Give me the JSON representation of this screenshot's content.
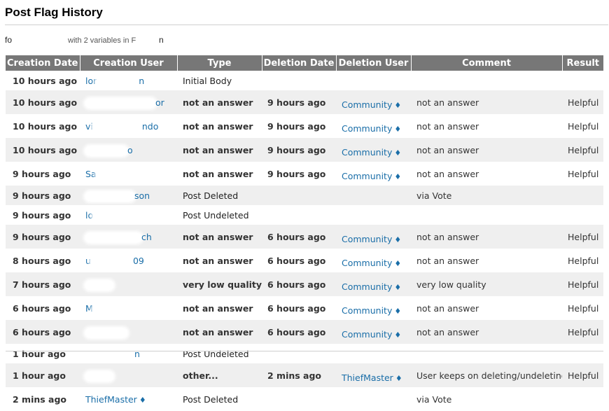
{
  "page": {
    "title": "Post Flag History"
  },
  "post": {
    "prefix": "fo",
    "middle": "with 2 variables in F",
    "suffix": "n"
  },
  "table": {
    "headers": [
      "Creation Date",
      "Creation User",
      "Type",
      "Deletion Date",
      "Deletion User",
      "Comment",
      "Result"
    ],
    "rows": [
      {
        "creation_date": "10 hours ago",
        "creation_user": "lor",
        "user_tail": "n",
        "type": "Initial Body",
        "type_bold": false,
        "deletion_date": "",
        "deletion_user": "",
        "comment": "",
        "result": ""
      },
      {
        "creation_date": "10 hours ago",
        "creation_user": "",
        "user_tail": "or",
        "type": "not an answer",
        "type_bold": true,
        "deletion_date": "9 hours ago",
        "deletion_user": "Community",
        "comment": "not an answer",
        "result": "Helpful"
      },
      {
        "creation_date": "10 hours ago",
        "creation_user": "vi",
        "user_tail": "ndo",
        "type": "not an answer",
        "type_bold": true,
        "deletion_date": "9 hours ago",
        "deletion_user": "Community",
        "comment": "not an answer",
        "result": "Helpful"
      },
      {
        "creation_date": "10 hours ago",
        "creation_user": "",
        "user_tail": "o",
        "type": "not an answer",
        "type_bold": true,
        "deletion_date": "9 hours ago",
        "deletion_user": "Community",
        "comment": "not an answer",
        "result": "Helpful"
      },
      {
        "creation_date": "9 hours ago",
        "creation_user": "Sa",
        "user_tail": "",
        "type": "not an answer",
        "type_bold": true,
        "deletion_date": "9 hours ago",
        "deletion_user": "Community",
        "comment": "not an answer",
        "result": "Helpful"
      },
      {
        "creation_date": "9 hours ago",
        "creation_user": "",
        "user_tail": "son",
        "type": "Post Deleted",
        "type_bold": false,
        "deletion_date": "",
        "deletion_user": "",
        "comment": "via Vote",
        "result": ""
      },
      {
        "creation_date": "9 hours ago",
        "creation_user": "lo",
        "user_tail": "",
        "type": "Post Undeleted",
        "type_bold": false,
        "deletion_date": "",
        "deletion_user": "",
        "comment": "",
        "result": ""
      },
      {
        "creation_date": "9 hours ago",
        "creation_user": "",
        "user_tail": "ch",
        "type": "not an answer",
        "type_bold": true,
        "deletion_date": "6 hours ago",
        "deletion_user": "Community",
        "comment": "not an answer",
        "result": "Helpful"
      },
      {
        "creation_date": "8 hours ago",
        "creation_user": "u",
        "user_tail": "09",
        "type": "not an answer",
        "type_bold": true,
        "deletion_date": "6 hours ago",
        "deletion_user": "Community",
        "comment": "not an answer",
        "result": "Helpful"
      },
      {
        "creation_date": "7 hours ago",
        "creation_user": "",
        "user_tail": "",
        "type": "very low quality",
        "type_bold": true,
        "deletion_date": "6 hours ago",
        "deletion_user": "Community",
        "comment": "very low quality",
        "result": "Helpful"
      },
      {
        "creation_date": "6 hours ago",
        "creation_user": "M",
        "user_tail": "",
        "type": "not an answer",
        "type_bold": true,
        "deletion_date": "6 hours ago",
        "deletion_user": "Community",
        "comment": "not an answer",
        "result": "Helpful"
      },
      {
        "creation_date": "6 hours ago",
        "creation_user": "",
        "user_tail": "",
        "type": "not an answer",
        "type_bold": true,
        "deletion_date": "6 hours ago",
        "deletion_user": "Community",
        "comment": "not an answer",
        "result": "Helpful"
      },
      {
        "creation_date": "1 hour ago",
        "creation_user": "",
        "user_tail": "n",
        "type": "Post Undeleted",
        "type_bold": false,
        "deletion_date": "",
        "deletion_user": "",
        "comment": "",
        "result": ""
      },
      {
        "creation_date": "1 hour ago",
        "creation_user": "",
        "user_tail": "",
        "type": "other...",
        "type_bold": true,
        "deletion_date": "2 mins ago",
        "deletion_user": "ThiefMaster",
        "comment": "User keeps on deleting/undeleting",
        "result": "Helpful"
      },
      {
        "creation_date": "2 mins ago",
        "creation_user": "ThiefMaster",
        "user_tail": "",
        "type": "Post Deleted",
        "type_bold": false,
        "deletion_date": "",
        "deletion_user": "",
        "comment": "via Vote",
        "result": ""
      }
    ]
  },
  "colors": {
    "header_bg": "#777777",
    "link": "#1a6ea8",
    "alt_row": "#efefef"
  },
  "icons": {
    "moderator": "diamond-icon"
  }
}
